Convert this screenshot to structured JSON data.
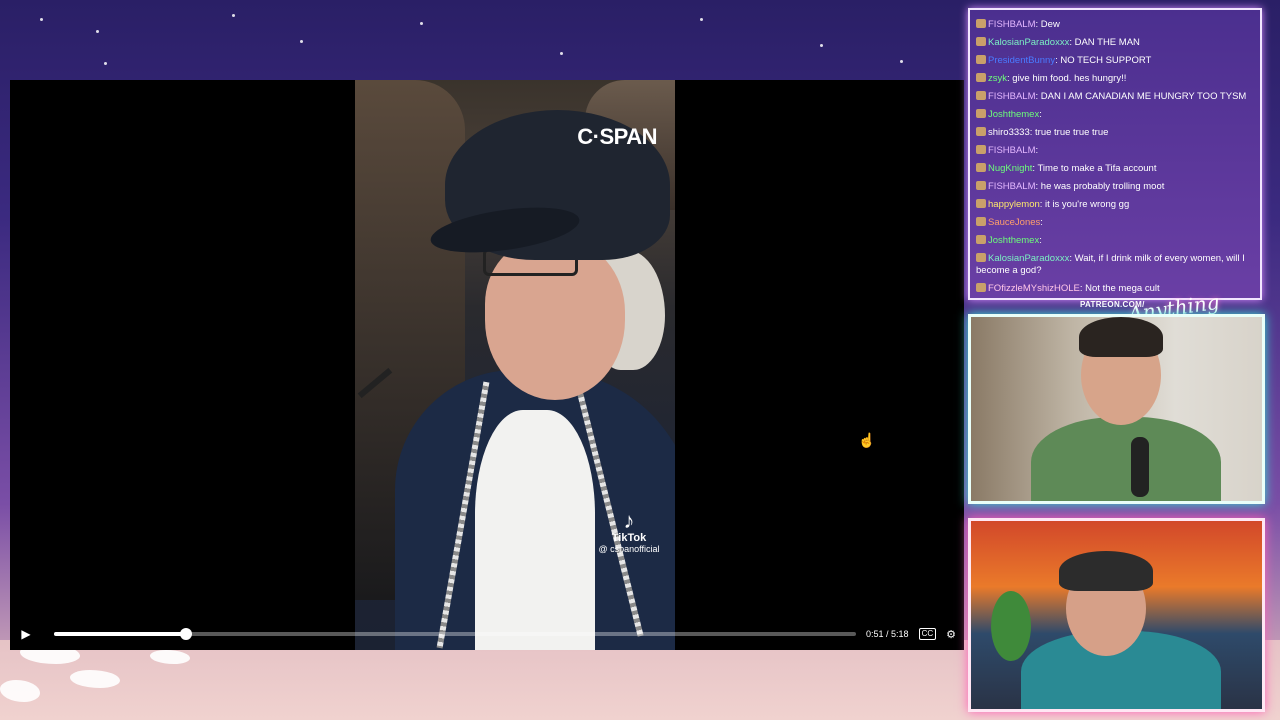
{
  "player": {
    "overlay_logo": "C·SPAN",
    "watermark_name": "TikTok",
    "watermark_handle": "@ cspanofficial",
    "time_display": "0:51 / 5:18",
    "progress_fraction": 0.164,
    "play_icon": "play-icon",
    "cc_label": "CC"
  },
  "chat": {
    "messages": [
      {
        "user": "FISHBALM",
        "color": "#e3b7ff",
        "text": "Dew"
      },
      {
        "user": "KalosianParadoxxx",
        "color": "#7cf2c4",
        "text": "DAN THE MAN"
      },
      {
        "user": "PresidentBunny",
        "color": "#4a7bff",
        "text": "NO TECH SUPPORT"
      },
      {
        "user": "zsyk",
        "color": "#6cff7a",
        "text": "give him food. hes hungry!!"
      },
      {
        "user": "FISHBALM",
        "color": "#e3b7ff",
        "text": "DAN I AM CANADIAN ME HUNGRY TOO TYSM"
      },
      {
        "user": "Joshthemex",
        "color": "#6cff7a",
        "text": ""
      },
      {
        "user": "shiro3333",
        "color": "#ffffff",
        "text": "true true true true"
      },
      {
        "user": "FISHBALM",
        "color": "#e3b7ff",
        "text": ""
      },
      {
        "user": "NugKnight",
        "color": "#6cff7a",
        "text": "Time to make a Tifa account"
      },
      {
        "user": "FISHBALM",
        "color": "#e3b7ff",
        "text": "he was probably trolling moot"
      },
      {
        "user": "happylemon",
        "color": "#ffe96c",
        "text": "it is you're wrong gg"
      },
      {
        "user": "SauceJones",
        "color": "#ff9f6c",
        "text": ""
      },
      {
        "user": "Joshthemex",
        "color": "#6cff7a",
        "text": ""
      },
      {
        "user": "KalosianParadoxxx",
        "color": "#7cf2c4",
        "text": "Wait, if I drink milk of every women, will I become a god?"
      },
      {
        "user": "FOfizzleMYshizHOLE",
        "color": "#ffc6e8",
        "text": "Not the mega cult"
      }
    ]
  },
  "overlay": {
    "patreon_text": "PATREON.COM/",
    "signature_text": "Anything"
  }
}
